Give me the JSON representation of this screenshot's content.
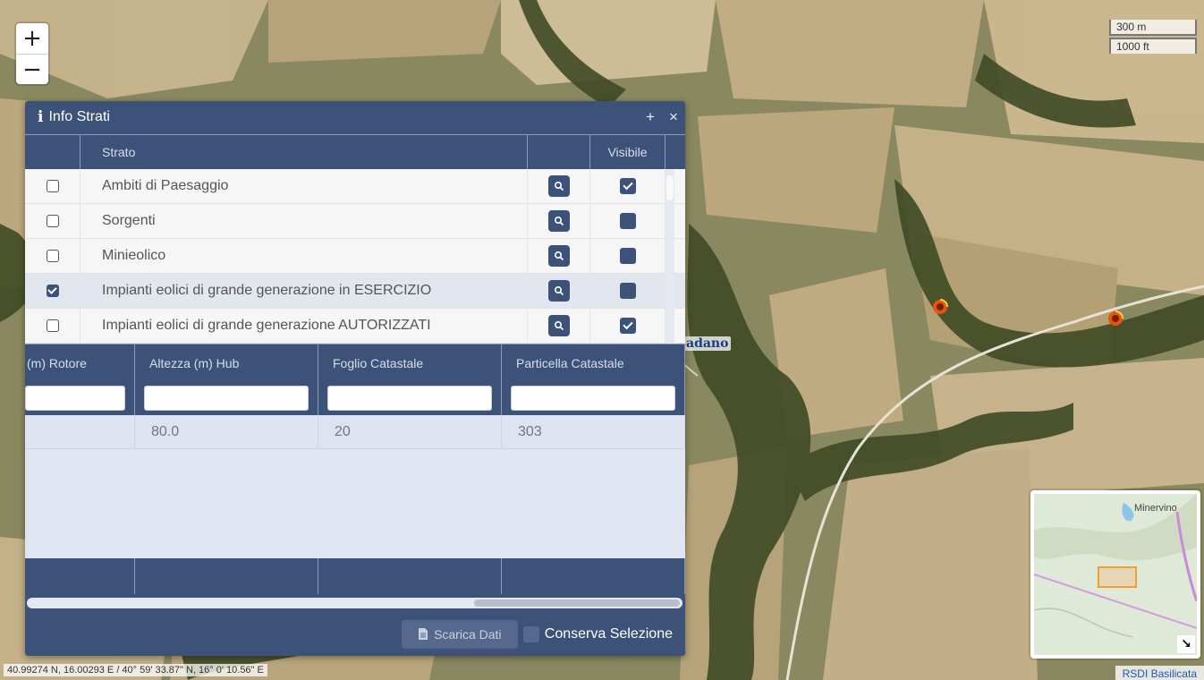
{
  "map": {
    "zoom_in": "+",
    "zoom_out": "−",
    "scale_metric": "300 m",
    "scale_imperial": "1000 ft",
    "place_label": "adano",
    "marker_icon": "wind-turbine-icon",
    "coordinates": "40.99274 N, 16.00293 E / 40° 59' 33.87\" N, 16° 0' 10.56\" E",
    "attribution": "RSDI Basilicata",
    "overview_label": "Minervino",
    "overview_toggle": "↘"
  },
  "panel": {
    "info_icon": "i",
    "title": "Info Strati",
    "add_button": "+",
    "close_button": "×",
    "layers_header": {
      "strato": "Strato",
      "visibile": "Visibile"
    },
    "layers": [
      {
        "name": "Ambiti di Paesaggio",
        "checked": false,
        "visible": true
      },
      {
        "name": "Sorgenti",
        "checked": false,
        "visible": false
      },
      {
        "name": "Minieolico",
        "checked": false,
        "visible": false
      },
      {
        "name": "Impianti eolici di grande generazione in ESERCIZIO",
        "checked": true,
        "visible": false
      },
      {
        "name": "Impianti eolici di grande generazione AUTORIZZATI",
        "checked": false,
        "visible": true
      }
    ],
    "attributes": {
      "columns": [
        "(m) Rotore",
        "Altezza (m) Hub",
        "Foglio Catastale",
        "Particella Catastale"
      ],
      "rows": [
        [
          "",
          "80.0",
          "20",
          "303"
        ]
      ]
    },
    "download_button": "Scarica Dati",
    "keep_selection": "Conserva Selezione"
  },
  "colors": {
    "panel": "#3d5278",
    "accent": "#3d5278"
  }
}
